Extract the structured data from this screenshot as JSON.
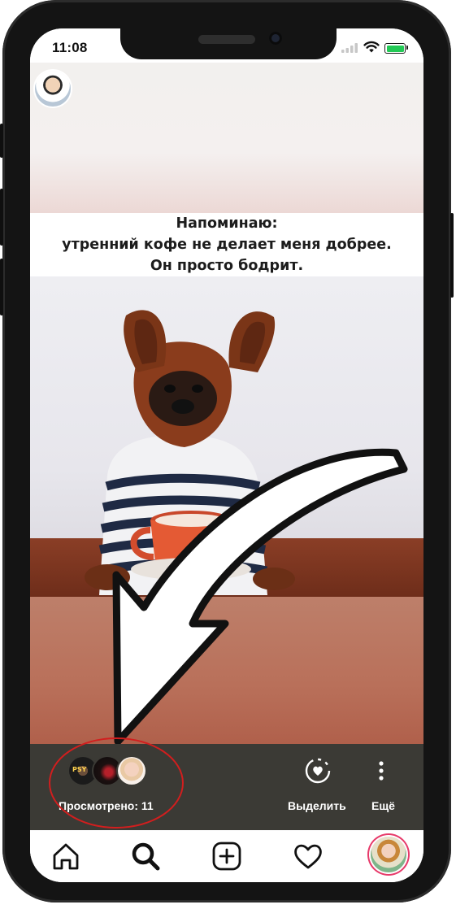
{
  "status_bar": {
    "time": "11:08"
  },
  "story": {
    "caption_lines": [
      "Напоминаю:",
      "утренний кофе не делает меня добрее.",
      "Он просто бодрит."
    ]
  },
  "story_footer": {
    "viewers_count_label": "Просмотрено: 11",
    "viewer_avatar_text": "PSY",
    "highlight_label": "Выделить",
    "more_label": "Ещё"
  },
  "bottom_nav": {
    "items": [
      "home-icon",
      "search-icon",
      "add-post-icon",
      "activity-heart-icon",
      "profile-avatar"
    ]
  },
  "colors": {
    "action_bar": "#3b3a35",
    "annotation_red": "#d21e1e",
    "battery_green": "#22c955"
  }
}
